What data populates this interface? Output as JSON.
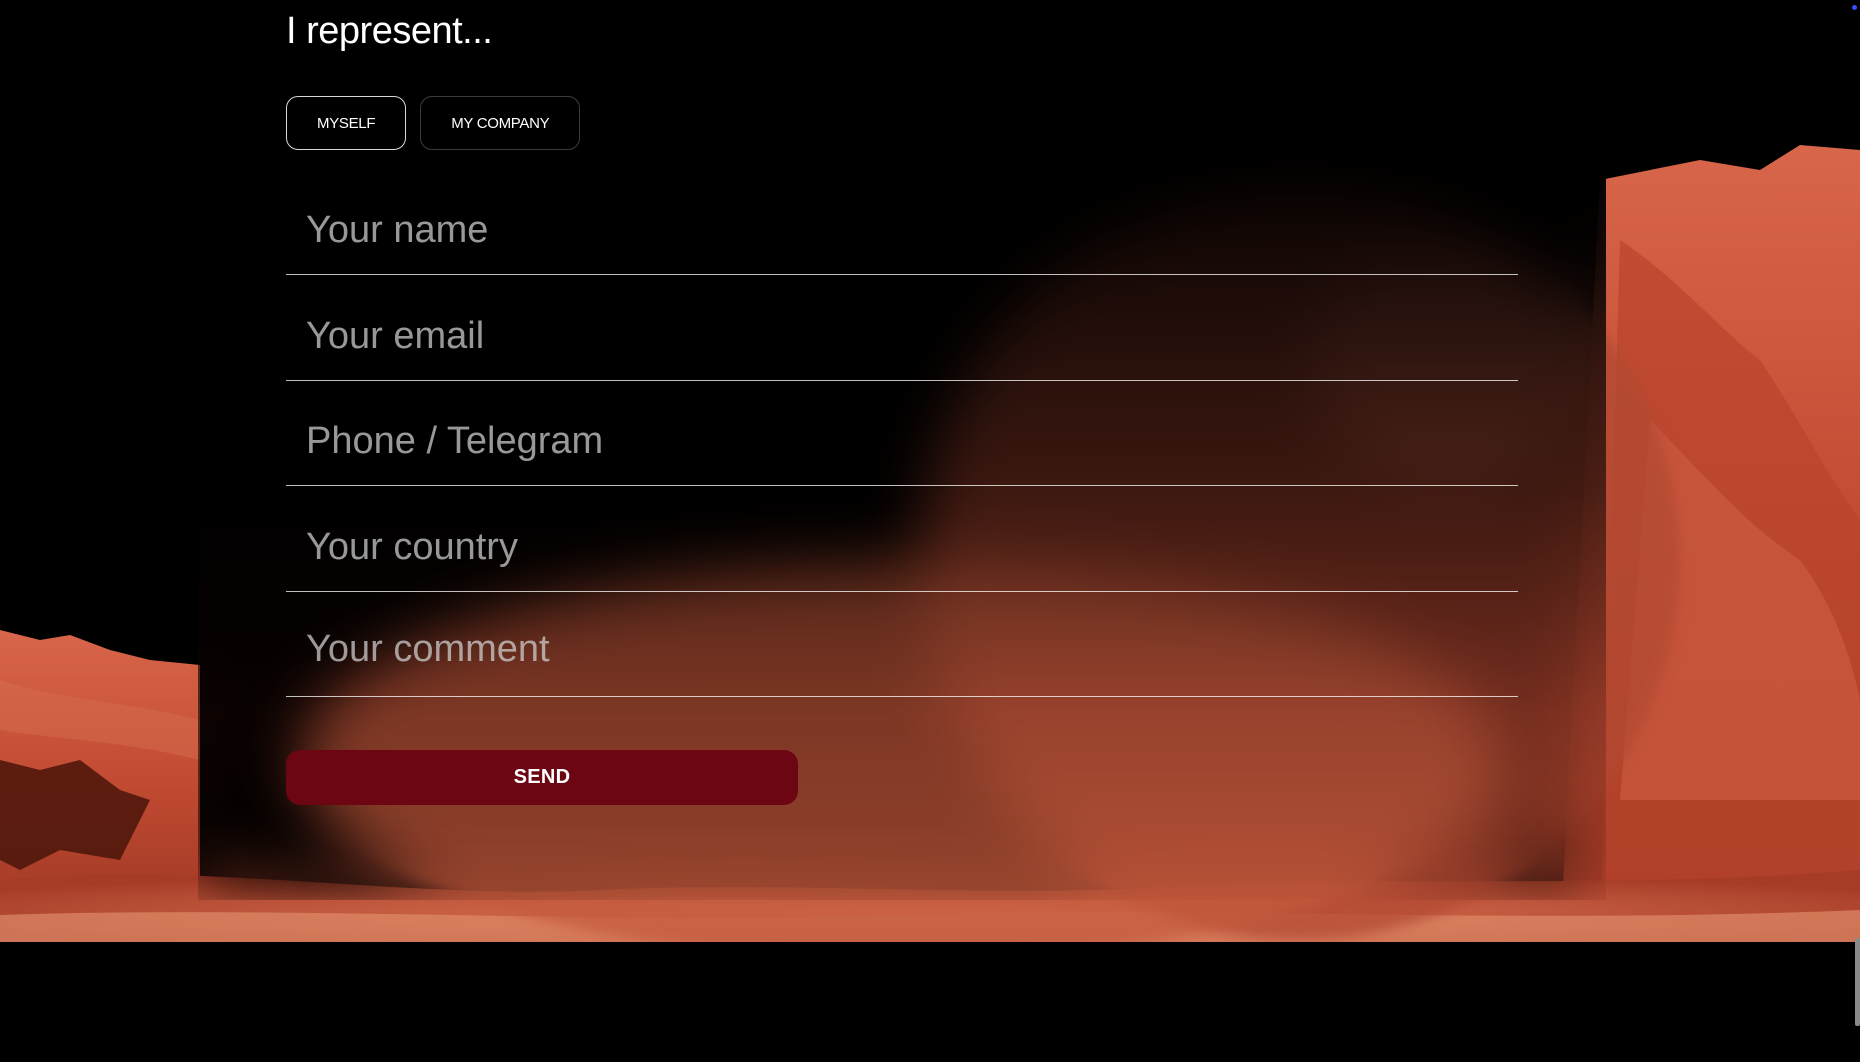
{
  "form": {
    "heading": "I represent...",
    "represent_options": [
      {
        "label": "MYSELF",
        "selected": true
      },
      {
        "label": "MY COMPANY",
        "selected": false
      }
    ],
    "fields": {
      "name_placeholder": "Your name",
      "email_placeholder": "Your email",
      "phone_placeholder": "Phone / Telegram",
      "country_placeholder": "Your country",
      "comment_placeholder": "Your comment"
    },
    "send_label": "SEND"
  },
  "colors": {
    "background": "#000000",
    "send_button": "#6b0612",
    "terrain": "#c8553a"
  }
}
